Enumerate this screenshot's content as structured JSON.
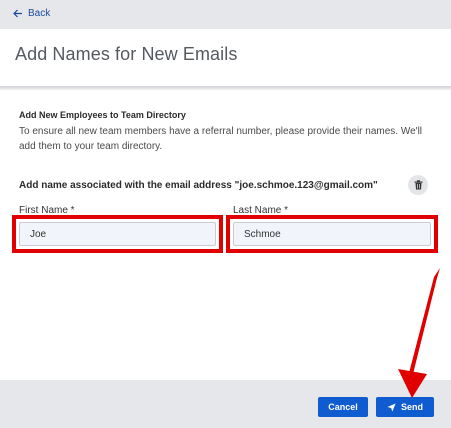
{
  "topbar": {
    "back_label": "Back"
  },
  "header": {
    "title": "Add Names for New Emails"
  },
  "section": {
    "title": "Add New Employees to Team Directory",
    "description": "To ensure all new team members have a referral number, please provide their names. We'll add them to your team directory."
  },
  "entry": {
    "email_heading": "Add name associated with the email address \"joe.schmoe.123@gmail.com\"",
    "first_name_label": "First Name *",
    "first_name_value": "Joe",
    "last_name_label": "Last Name *",
    "last_name_value": "Schmoe"
  },
  "footer": {
    "cancel_label": "Cancel",
    "send_label": "Send"
  },
  "colors": {
    "primary": "#0f5bd0",
    "highlight": "#e00000",
    "topbar_bg": "#e6e7ea"
  },
  "icons": {
    "back": "arrow-left-icon",
    "trash": "trash-icon",
    "send": "paper-plane-icon"
  }
}
